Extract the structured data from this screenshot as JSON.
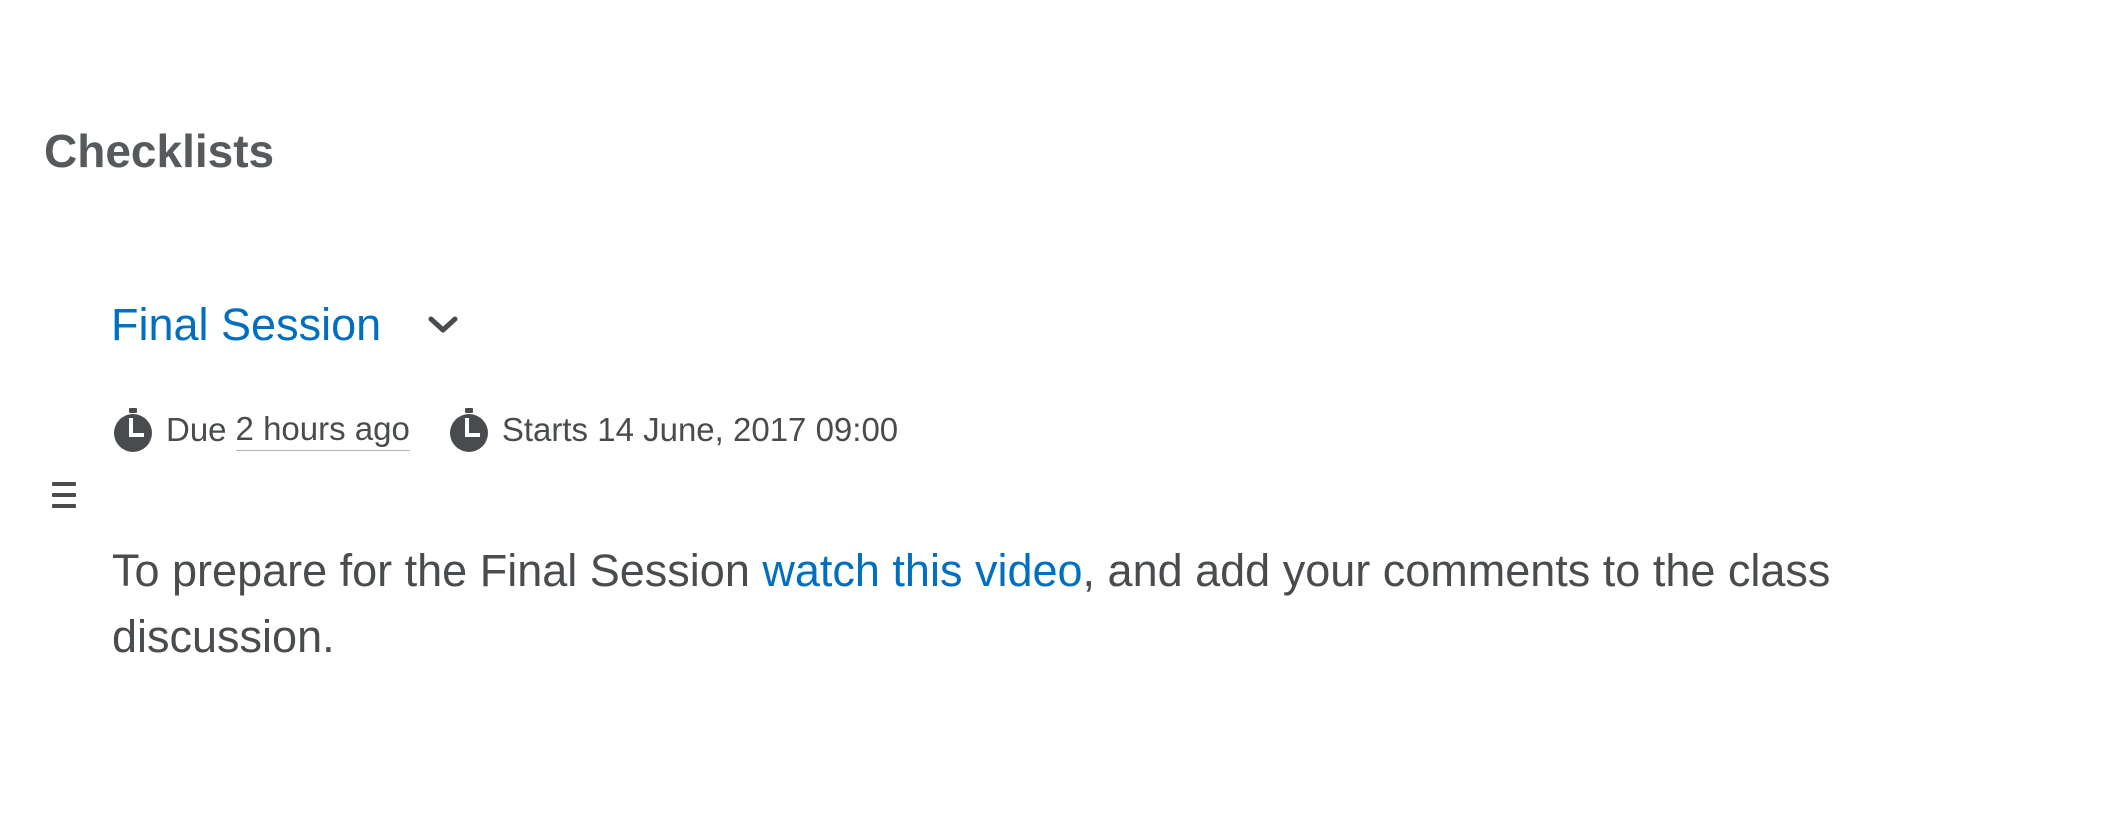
{
  "page": {
    "heading": "Checklists"
  },
  "checklist_item": {
    "title": "Final Session",
    "due_prefix": "Due",
    "due_relative": "2 hours ago",
    "start_text": "Starts 14 June, 2017 09:00",
    "description": {
      "before_link": "To prepare for the Final Session ",
      "link_text": "watch this video",
      "after_link": ", and add your comments to the class discussion."
    }
  },
  "icons": {
    "drag_handle": "drag-handle-icon",
    "expand": "chevron-down-icon",
    "due": "clock-icon",
    "start": "clock-icon"
  },
  "colors": {
    "link": "#006fbf",
    "text": "#494c4e",
    "heading": "#565a5c"
  }
}
